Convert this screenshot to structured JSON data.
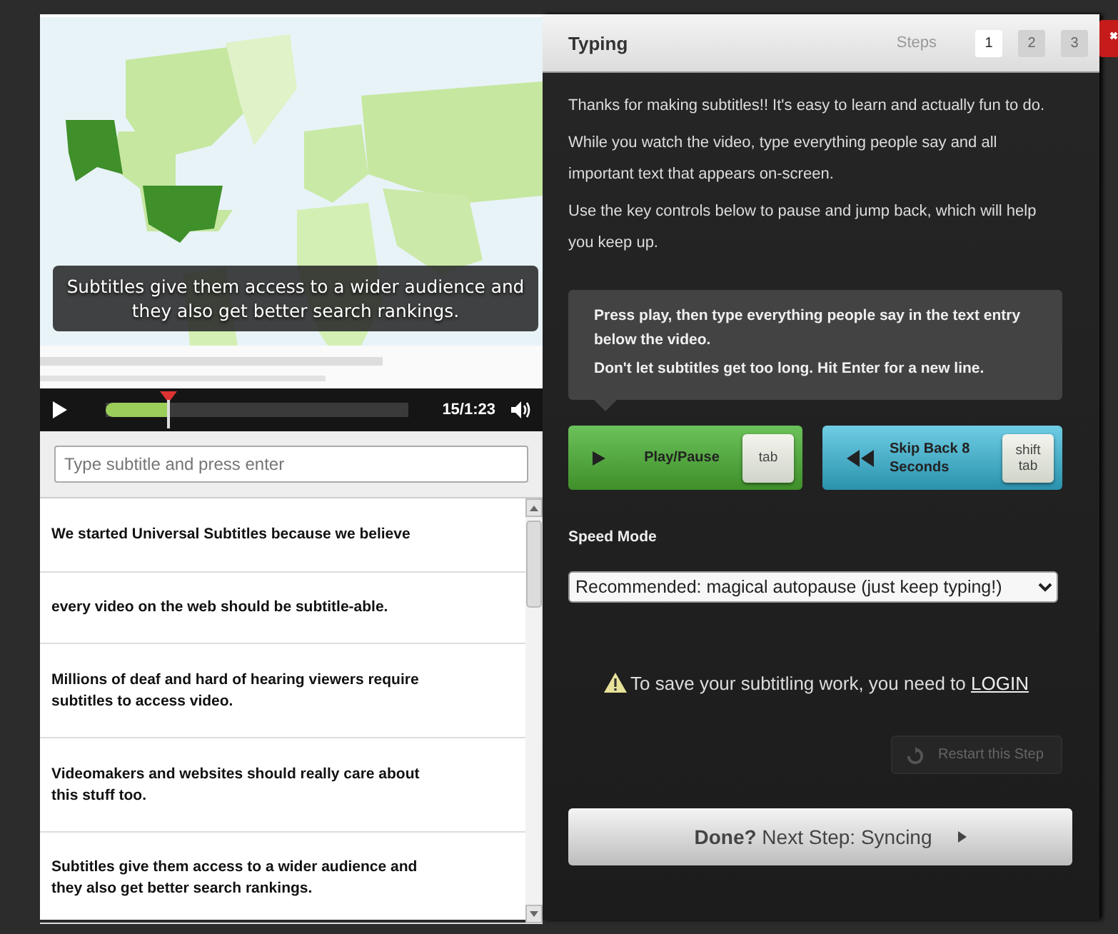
{
  "video": {
    "kind": "picture",
    "caption": "Subtitles give them access to a wider audience and they also get better search rankings.",
    "progress": {
      "level": 0.21
    },
    "time": "15/1:23"
  },
  "subtitle_input": {
    "placeholder": "Type subtitle and press enter"
  },
  "subtitles": [
    {
      "text": "We started Universal Subtitles because we believe"
    },
    {
      "text": "every video on the web should be subtitle-able."
    },
    {
      "text": "Millions of deaf and hard of hearing viewers require subtitles to access video."
    },
    {
      "text": "Videomakers and websites should really care about this stuff too."
    },
    {
      "text": "Subtitles give them access to a wider audience and they also get better search rankings."
    }
  ],
  "panel": {
    "title": "Typing",
    "steps_label": "Steps",
    "steps": [
      {
        "label": "1",
        "selected": true
      },
      {
        "label": "2",
        "selected": false
      },
      {
        "label": "3",
        "selected": false
      }
    ],
    "intro": [
      "Thanks for making subtitles!! It's easy to learn and actually fun to do.",
      "While you watch the video, type everything people say and all important text that appears on-screen.",
      "Use the key controls below to pause and jump back, which will help you keep up."
    ],
    "tip": [
      "Press play, then type everything people say in the text entry below the video.",
      "Don't let subtitles get too long. Hit Enter for a new line."
    ],
    "controls": [
      {
        "kind": "play",
        "label": "Play/Pause",
        "key": "tab"
      },
      {
        "kind": "skip",
        "label": "Skip Back 8 Seconds",
        "key": "shift tab"
      }
    ],
    "speed_mode": {
      "label": "Speed Mode",
      "value": "Recommended: magical autopause (just keep typing!)"
    },
    "login_notice": {
      "text": "To save your subtitling work, you need to ",
      "link": "LOGIN"
    },
    "restart": {
      "label": "Restart this Step",
      "disabled": true
    },
    "next": {
      "label": "**Done?** Next Step: Syncing"
    }
  }
}
